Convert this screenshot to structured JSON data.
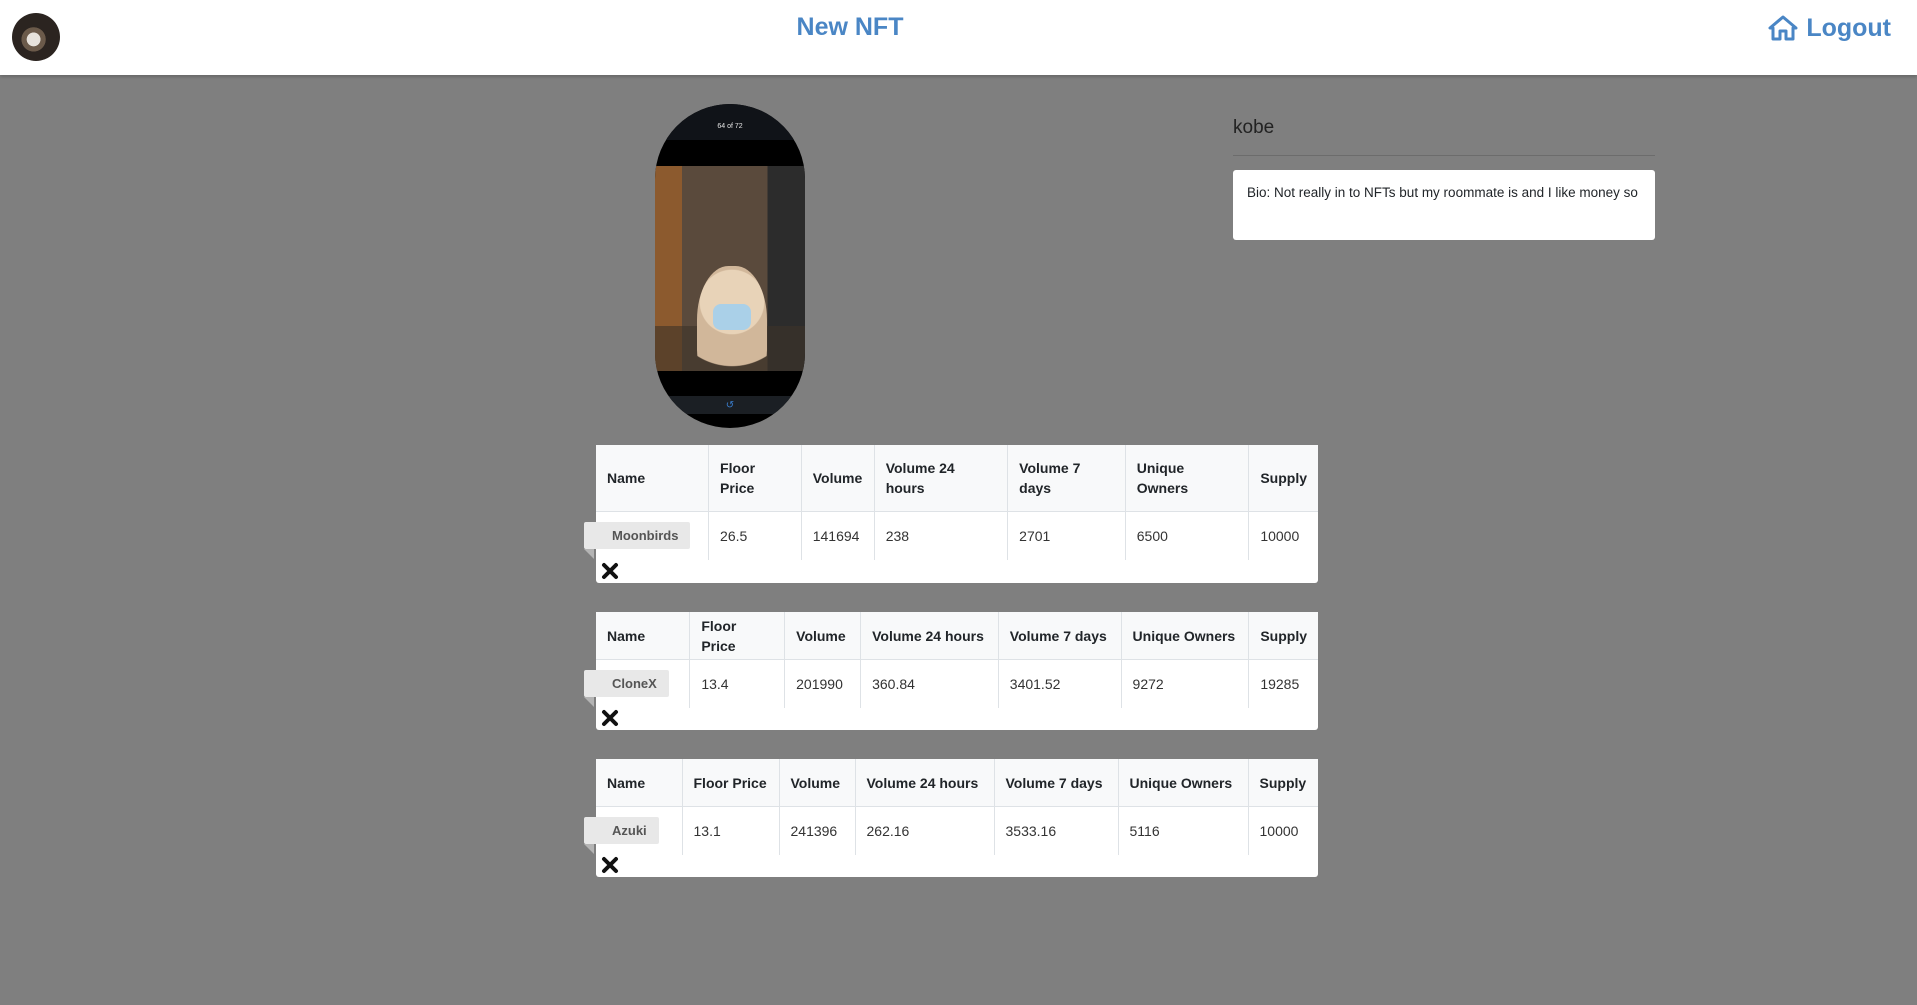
{
  "navbar": {
    "brand": "New NFT",
    "logout_label": "Logout",
    "home_icon": "home-icon",
    "avatar": "user-avatar"
  },
  "profile": {
    "photo_counter": "64 of 72",
    "share_icon": "share-icon",
    "username": "kobe",
    "bio": "Bio: Not really in to NFTs but my roommate is and I like money so"
  },
  "collections": [
    {
      "headers": [
        "Name",
        "Floor Price",
        "Volume",
        "Volume 24 hours",
        "Volume 7 days",
        "Unique Owners",
        "Supply"
      ],
      "name": "Moonbirds",
      "floor_price": "26.5",
      "volume": "141694",
      "volume_24h": "238",
      "volume_7d": "2701",
      "unique_owners": "6500",
      "supply": "10000",
      "remove_icon": "close-icon"
    },
    {
      "headers": [
        "Name",
        "Floor Price",
        "Volume",
        "Volume 24 hours",
        "Volume 7 days",
        "Unique Owners",
        "Supply"
      ],
      "name": "CloneX",
      "floor_price": "13.4",
      "volume": "201990",
      "volume_24h": "360.84",
      "volume_7d": "3401.52",
      "unique_owners": "9272",
      "supply": "19285",
      "remove_icon": "close-icon"
    },
    {
      "headers": [
        "Name",
        "Floor Price",
        "Volume",
        "Volume 24 hours",
        "Volume 7 days",
        "Unique Owners",
        "Supply"
      ],
      "name": "Azuki",
      "floor_price": "13.1",
      "volume": "241396",
      "volume_24h": "262.16",
      "volume_7d": "3533.16",
      "unique_owners": "5116",
      "supply": "10000",
      "remove_icon": "close-icon"
    }
  ],
  "colors": {
    "brand": "#4a86c5",
    "background": "#7f7f7f",
    "card": "#ffffff"
  }
}
